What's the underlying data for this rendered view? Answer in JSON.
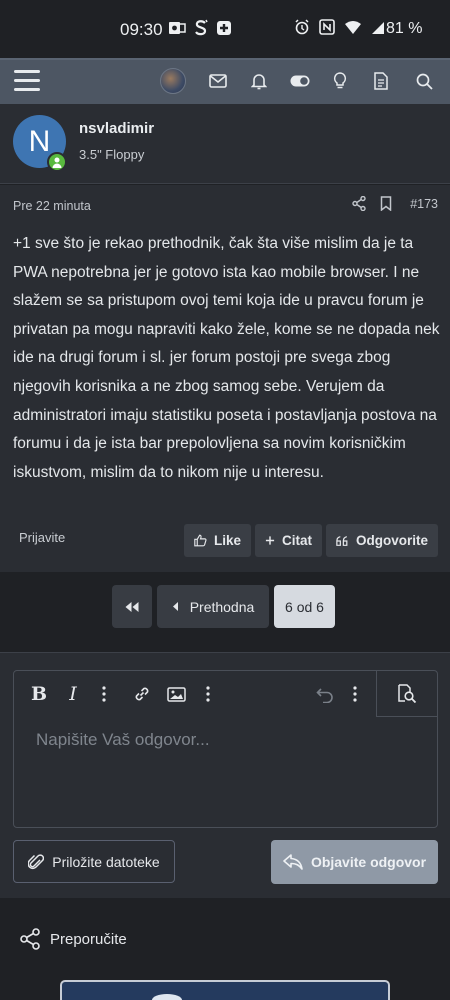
{
  "status_bar": {
    "time": "09:30",
    "battery": "81 %"
  },
  "post": {
    "user": {
      "initial": "N",
      "name": "nsvladimir",
      "title": "3.5\" Floppy"
    },
    "time_ago": "Pre 22 minuta",
    "number": "#173",
    "content": "+1 sve što je rekao prethodnik, čak šta više mislim da je ta PWA nepotrebna jer je gotovo ista kao mobile browser. I ne slažem se sa pristupom ovoj temi koja ide u pravcu forum je privatan pa mogu napraviti kako žele, kome se ne dopada nek ide na drugi forum i sl. jer forum postoji pre svega zbog njegovih korisnika a ne zbog samog sebe. Verujem da administratori imaju statistiku poseta i postavljanja postova na forumu i da je ista bar prepolovljena sa novim korisničkim iskustvom, mislim da to nikom nije u interesu.",
    "report_label": "Prijavite",
    "actions": {
      "like": "Like",
      "quote": "Citat",
      "reply": "Odgovorite"
    }
  },
  "pagination": {
    "prev_label": "Prethodna",
    "current": "6 od 6"
  },
  "reply": {
    "placeholder": "Napišite Vaš odgovor...",
    "attach_label": "Priložite datoteke",
    "submit_label": "Objavite odgovor"
  },
  "share_label": "Preporučite",
  "colors": {
    "accent": "#3e75b2",
    "online": "#58b93e",
    "navbar": "#4d5663",
    "submit": "#8f99a6"
  }
}
